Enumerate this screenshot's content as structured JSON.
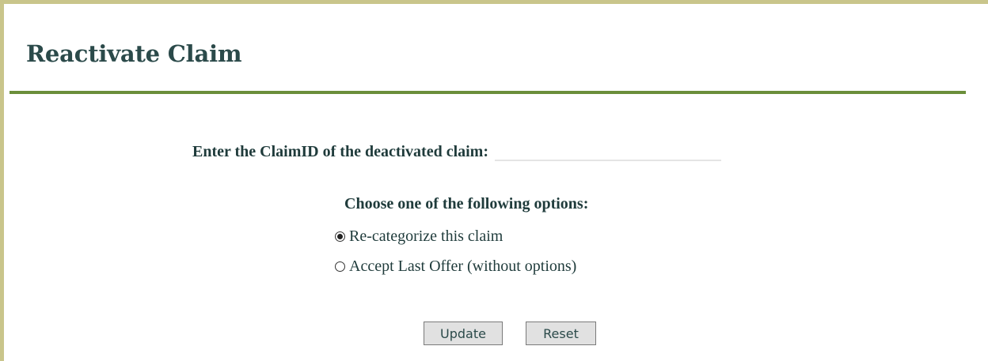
{
  "page": {
    "title": "Reactivate Claim"
  },
  "claim_form": {
    "claim_id_label": "Enter the ClaimID of the deactivated claim:",
    "claim_id_value": "",
    "options_heading": "Choose one of the following options:",
    "options": [
      {
        "label": "Re-categorize this claim",
        "selected": true
      },
      {
        "label": "Accept Last Offer (without options)",
        "selected": false
      }
    ],
    "update_label": "Update",
    "reset_label": "Reset"
  },
  "colors": {
    "frame_border": "#c9c58b",
    "rule": "#6b8e3a",
    "text": "#1f3b3b"
  }
}
